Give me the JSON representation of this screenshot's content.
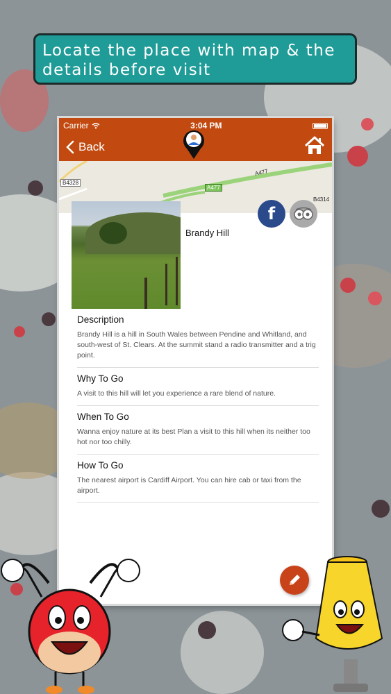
{
  "banner": {
    "text": "Locate the place with map & the details before visit"
  },
  "status_bar": {
    "carrier": "Carrier",
    "time": "3:04 PM"
  },
  "nav": {
    "back_label": "Back"
  },
  "map": {
    "road_labels": [
      "A477",
      "A477",
      "B4328",
      "B4314"
    ]
  },
  "place": {
    "name": "Brandy Hill"
  },
  "social": {
    "facebook_glyph": "f"
  },
  "sections": [
    {
      "title": "Description",
      "body": "Brandy Hill is a hill in South Wales between Pendine and Whitland, and south-west of St. Clears. At the summit stand a radio transmitter and a trig point."
    },
    {
      "title": "Why To Go",
      "body": "A visit to this hill will let you experience a rare blend of nature."
    },
    {
      "title": "When To Go",
      "body": "Wanna enjoy nature at its best Plan a visit to this hill when its neither too hot nor too chilly."
    },
    {
      "title": "How To Go",
      "body": "The nearest airport is Cardiff Airport. You can hire cab or taxi from the airport."
    }
  ],
  "colors": {
    "nav_bg": "#c24a10",
    "banner_bg": "#1f9c98",
    "edit_button": "#c9431a",
    "facebook": "#2b4a8c"
  },
  "icons": [
    "back-chevron-icon",
    "home-icon",
    "user-pin-icon",
    "facebook-icon",
    "tripadvisor-icon",
    "pencil-icon",
    "wifi-icon",
    "battery-icon"
  ]
}
